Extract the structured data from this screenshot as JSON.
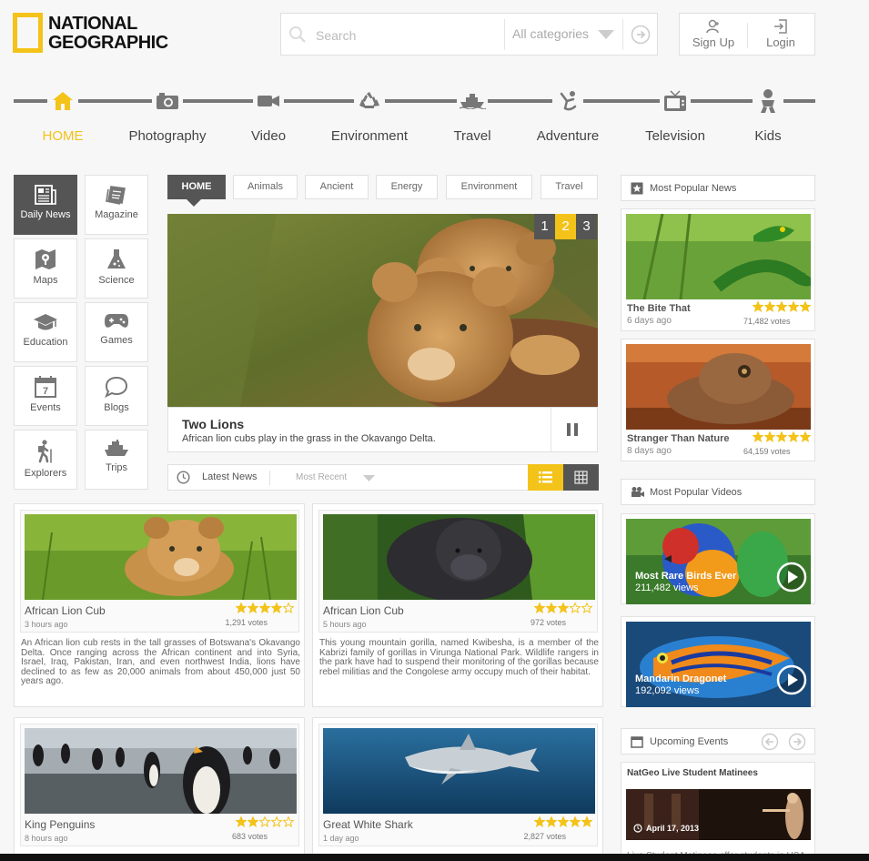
{
  "brand": {
    "line1": "NATIONAL",
    "line2": "GEOGRAPHIC",
    "accent": "#f3c31a"
  },
  "search": {
    "placeholder": "Search",
    "category": "All categories"
  },
  "auth": {
    "signup": "Sign Up",
    "login": "Login"
  },
  "nav": [
    {
      "label": "HOME",
      "icon": "home-icon",
      "active": true
    },
    {
      "label": "Photography",
      "icon": "camera-icon"
    },
    {
      "label": "Video",
      "icon": "video-camera-icon"
    },
    {
      "label": "Environment",
      "icon": "recycle-icon"
    },
    {
      "label": "Travel",
      "icon": "ship-icon"
    },
    {
      "label": "Adventure",
      "icon": "diver-icon"
    },
    {
      "label": "Television",
      "icon": "tv-icon"
    },
    {
      "label": "Kids",
      "icon": "baby-icon"
    }
  ],
  "sections": [
    {
      "label": "Daily News",
      "icon": "newspaper-icon",
      "active": true
    },
    {
      "label": "Magazine",
      "icon": "magazine-icon"
    },
    {
      "label": "Maps",
      "icon": "map-icon"
    },
    {
      "label": "Science",
      "icon": "flask-icon"
    },
    {
      "label": "Education",
      "icon": "graduation-cap-icon"
    },
    {
      "label": "Games",
      "icon": "gamepad-icon"
    },
    {
      "label": "Events",
      "icon": "calendar-icon"
    },
    {
      "label": "Blogs",
      "icon": "speech-bubble-icon"
    },
    {
      "label": "Explorers",
      "icon": "hiker-icon"
    },
    {
      "label": "Trips",
      "icon": "cruise-ship-icon"
    }
  ],
  "tabs": [
    "HOME",
    "Animals",
    "Ancient",
    "Energy",
    "Environment",
    "Travel"
  ],
  "slider": {
    "pages": [
      "1",
      "2",
      "3"
    ],
    "active_page": 2,
    "title": "Two Lions",
    "description": "African lion cubs play in the grass in the Okavango Delta."
  },
  "latest": {
    "label": "Latest News",
    "sort": "Most Recent"
  },
  "articles": [
    {
      "title": "African Lion Cub",
      "age": "3 hours ago",
      "rating": 4,
      "votes": "1,291 votes",
      "description": "An African lion cub rests in the tall grasses of Botswana's Okavango Delta. Once ranging across the African continent and into Syria, Israel, Iraq, Pakistan, Iran, and even northwest India, lions have declined to as few as 20,000 animals from about 450,000 just 50 years ago."
    },
    {
      "title": "African Lion Cub",
      "age": "5 hours ago",
      "rating": 3,
      "votes": "972 votes",
      "description": "This young mountain gorilla, named Kwibesha, is a member of the Kabrizi family of gorillas in Virunga National Park. Wildlife rangers in the park have had to suspend their monitoring of the gorillas because rebel militias and the Congolese army occupy much of their habitat."
    },
    {
      "title": "King Penguins",
      "age": "8 hours ago",
      "rating": 2,
      "votes": "683 votes"
    },
    {
      "title": "Great White Shark",
      "age": "1 day ago",
      "rating": 5,
      "votes": "2,827 votes"
    }
  ],
  "popular_news": {
    "heading": "Most Popular News",
    "items": [
      {
        "title": "The Bite That",
        "age": "6 days ago",
        "rating": 5,
        "votes": "71,482 votes"
      },
      {
        "title": "Stranger Than Nature",
        "age": "8 days ago",
        "rating": 5,
        "votes": "64,159 votes"
      }
    ]
  },
  "popular_videos": {
    "heading": "Most Popular Videos",
    "items": [
      {
        "title": "Most Rare Birds Ever",
        "views": "211,482 views"
      },
      {
        "title": "Mandarin Dragonet",
        "views": "192,092 views"
      }
    ]
  },
  "events": {
    "heading": "Upcoming Events",
    "item_title": "NatGeo Live Student Matinees",
    "date": "April 17, 2013",
    "teaser": "Live Student Matinees offer students in USA"
  }
}
